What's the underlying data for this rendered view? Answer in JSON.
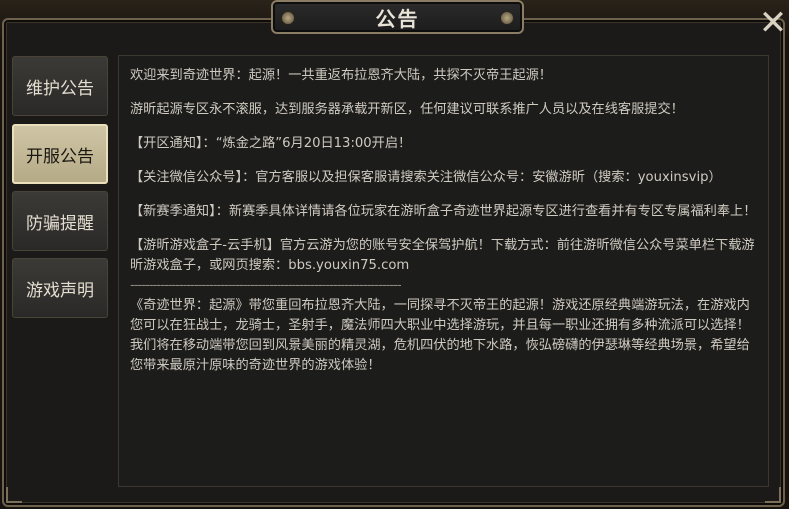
{
  "dialog": {
    "title": "公告",
    "close_label": "✕"
  },
  "tabs": [
    {
      "label": "维护公告",
      "active": false
    },
    {
      "label": "开服公告",
      "active": true
    },
    {
      "label": "防骗提醒",
      "active": false
    },
    {
      "label": "游戏声明",
      "active": false
    }
  ],
  "content": {
    "p1": "欢迎来到奇迹世界：起源！一共重返布拉恩齐大陆，共探不灭帝王起源！",
    "p2": "游昕起源专区永不滚服，达到服务器承载开新区，任何建议可联系推广人员以及在线客服提交！",
    "p3": "【开区通知】：“炼金之路”6月20日13:00开启！",
    "p4": "【关注微信公众号】：官方客服以及担保客服请搜索关注微信公众号：安徽游昕（搜索：youxinsvip）",
    "p5": "【新赛季通知】：新赛季具体详情请各位玩家在游昕盒子奇迹世界起源专区进行查看并有专区专属福利奉上！",
    "p6": "【游昕游戏盒子-云手机】官方云游为您的账号安全保驾护航！下载方式：前往游昕微信公众号菜单栏下载游昕游戏盒子，或网页搜索：bbs.youxin75.com",
    "divider": "------------------------------------------------------------------------",
    "p7": "《奇迹世界：起源》带您重回布拉恩齐大陆，一同探寻不灭帝王的起源！游戏还原经典端游玩法，在游戏内您可以在狂战士，龙骑士，圣射手，魔法师四大职业中选择游玩，并且每一职业还拥有多种流派可以选择！",
    "p8": "我们将在移动端带您回到风景美丽的精灵湖，危机四伏的地下水路，恢弘磅礴的伊瑟琳等经典场景，希望给您带来最原汁原味的奇迹世界的游戏体验！"
  }
}
